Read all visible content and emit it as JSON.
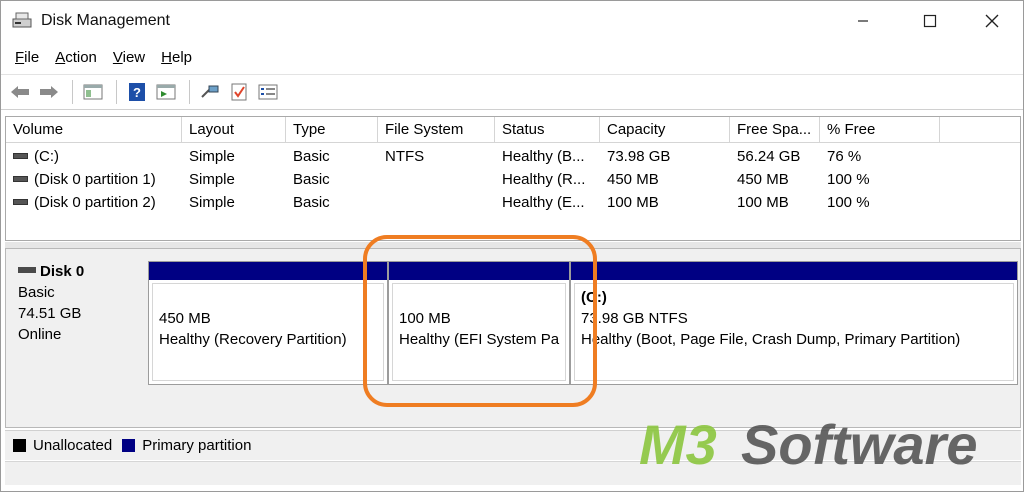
{
  "window": {
    "title": "Disk Management",
    "buttons": {
      "minimize": "—",
      "maximize": "☐",
      "close": "✕"
    }
  },
  "menu": [
    {
      "label": "File",
      "accel": "F",
      "rest": "ile"
    },
    {
      "label": "Action",
      "accel": "A",
      "rest": "ction"
    },
    {
      "label": "View",
      "accel": "V",
      "rest": "iew"
    },
    {
      "label": "Help",
      "accel": "H",
      "rest": "elp"
    }
  ],
  "toolbar": {
    "icons": [
      "back-arrow-icon",
      "forward-arrow-icon",
      "console-tree-icon",
      "help-icon",
      "action-pane-icon",
      "connect-icon",
      "check-icon",
      "properties-icon"
    ]
  },
  "volume_list": {
    "columns": [
      "Volume",
      "Layout",
      "Type",
      "File System",
      "Status",
      "Capacity",
      "Free Spa...",
      "% Free"
    ],
    "rows": [
      [
        "(C:)",
        "Simple",
        "Basic",
        "NTFS",
        "Healthy (B...",
        "73.98 GB",
        "56.24 GB",
        "76 %"
      ],
      [
        "(Disk 0 partition 1)",
        "Simple",
        "Basic",
        "",
        "Healthy (R...",
        "450 MB",
        "450 MB",
        "100 %"
      ],
      [
        "(Disk 0 partition 2)",
        "Simple",
        "Basic",
        "",
        "Healthy (E...",
        "100 MB",
        "100 MB",
        "100 %"
      ]
    ]
  },
  "disk": {
    "name": "Disk 0",
    "type": "Basic",
    "size": "74.51 GB",
    "state": "Online"
  },
  "partitions": [
    {
      "title": "",
      "size": "450 MB",
      "status": "Healthy (Recovery Partition)"
    },
    {
      "title": "",
      "size": "100 MB",
      "status": "Healthy (EFI System Pa"
    },
    {
      "title": "(C:)",
      "size": "73.98 GB NTFS",
      "status": "Healthy (Boot, Page File, Crash Dump, Primary Partition)"
    }
  ],
  "legend": [
    {
      "label": "Unallocated",
      "color": "#000000"
    },
    {
      "label": "Primary partition",
      "color": "#000083"
    }
  ],
  "colors": {
    "partition_bar": "#000083",
    "highlight": "#ef7d22",
    "watermark_green": "#8cc63f",
    "watermark_gray": "#4d4d4d"
  },
  "watermark": {
    "prefix": "M3",
    "suffix": "Software"
  }
}
